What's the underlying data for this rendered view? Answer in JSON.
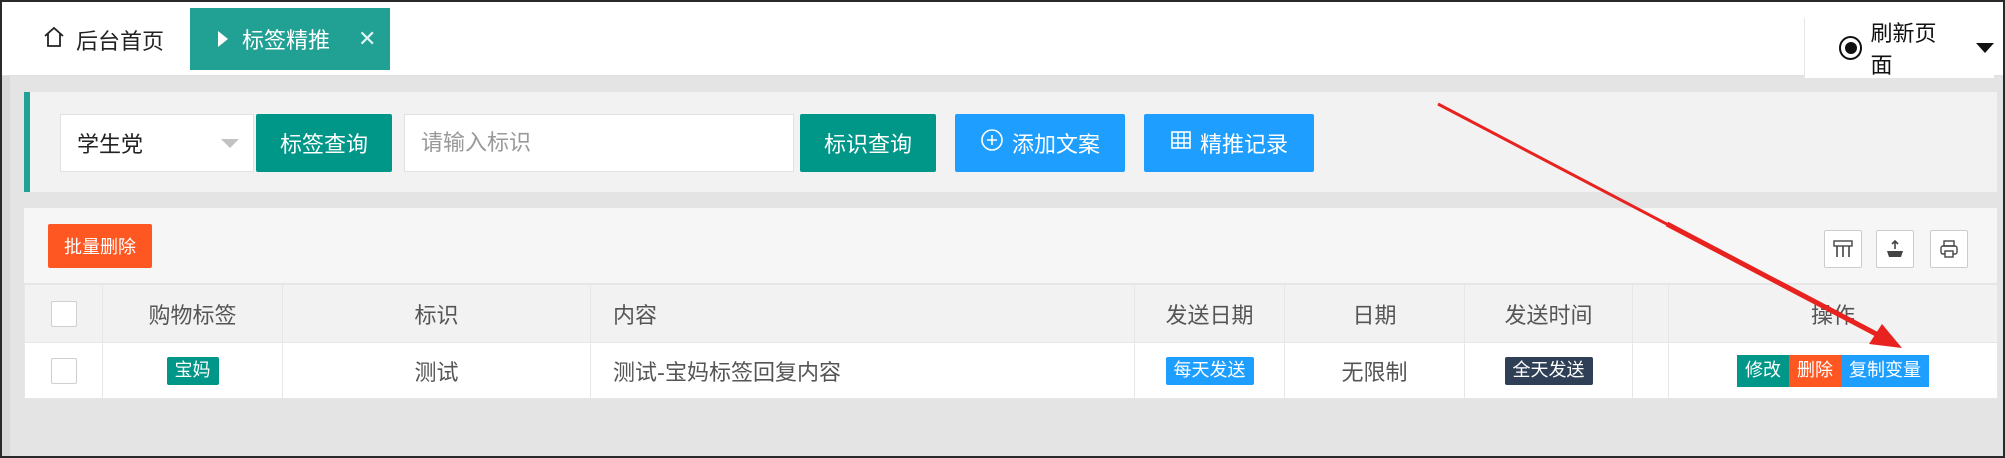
{
  "tabs": {
    "home_label": "后台首页",
    "active_label": "标签精推",
    "close_glyph": "✕"
  },
  "refresh": {
    "label": "刷新页面"
  },
  "search": {
    "select_value": "学生党",
    "tag_query_label": "标签查询",
    "id_placeholder": "请输入标识",
    "id_query_label": "标识查询",
    "add_copy_label": "添加文案",
    "push_records_label": "精推记录"
  },
  "toolbar": {
    "batch_delete_label": "批量删除",
    "icons": [
      "columns-icon",
      "export-icon",
      "print-icon"
    ]
  },
  "table": {
    "headers": [
      "",
      "购物标签",
      "标识",
      "内容",
      "发送日期",
      "日期",
      "发送时间",
      "",
      "操作"
    ],
    "rows": [
      {
        "tag": "宝妈",
        "id": "测试",
        "content": "测试-宝妈标签回复内容",
        "send_date": "每天发送",
        "date": "无限制",
        "send_time": "全天发送",
        "actions": [
          "修改",
          "删除",
          "复制变量"
        ]
      }
    ]
  },
  "colors": {
    "teal": "#009688",
    "tab_teal": "#21a094",
    "blue": "#1e9fff",
    "orange": "#ff5722",
    "dark": "#2f4056",
    "annotation_red": "#e8231f"
  }
}
